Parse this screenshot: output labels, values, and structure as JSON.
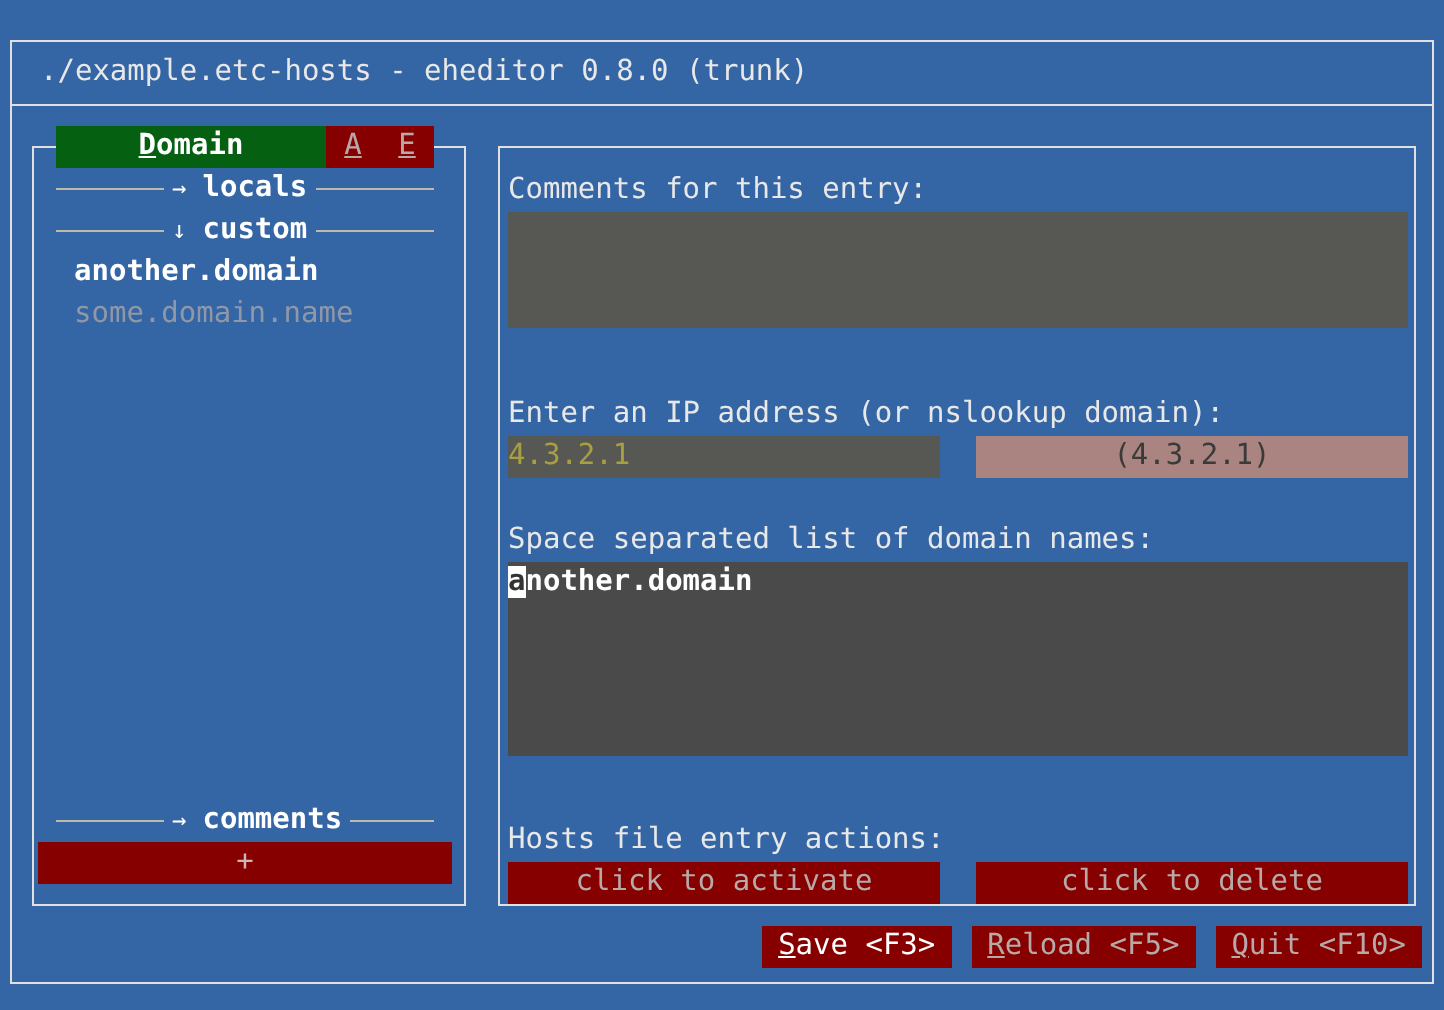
{
  "window": {
    "title": "./example.etc-hosts - eheditor 0.8.0 (trunk)"
  },
  "sidebar": {
    "tabs": [
      {
        "hotkey": "D",
        "rest": "omain",
        "selected": true
      },
      {
        "hotkey": "A",
        "selected": false
      },
      {
        "hotkey": "E",
        "selected": false
      }
    ],
    "groups": [
      {
        "arrow": "→",
        "label": "locals"
      },
      {
        "arrow": "↓",
        "label": "custom",
        "children": [
          {
            "label": "another.domain",
            "selected": true
          },
          {
            "label": "some.domain.name",
            "selected": false
          }
        ]
      }
    ],
    "footer_group": {
      "arrow": "→",
      "label": "comments"
    },
    "add_button": "+"
  },
  "entry": {
    "comments_label": "Comments for this entry:",
    "ip_label": "Enter an IP address (or nslookup domain):",
    "ip_value": "4.3.2.1",
    "ip_resolved": "(4.3.2.1)",
    "names_label": "Space separated list of domain names:",
    "names_value": "another.domain",
    "actions_label": "Hosts file entry actions:",
    "actions": [
      "click to activate",
      "click to delete"
    ]
  },
  "buttons": [
    {
      "hotkey": "S",
      "rest": "ave <F3>",
      "selected": true
    },
    {
      "hotkey": "R",
      "rest": "eload <F5>",
      "selected": false
    },
    {
      "hotkey": "Q",
      "rest": "uit <F10>",
      "selected": false
    }
  ]
}
